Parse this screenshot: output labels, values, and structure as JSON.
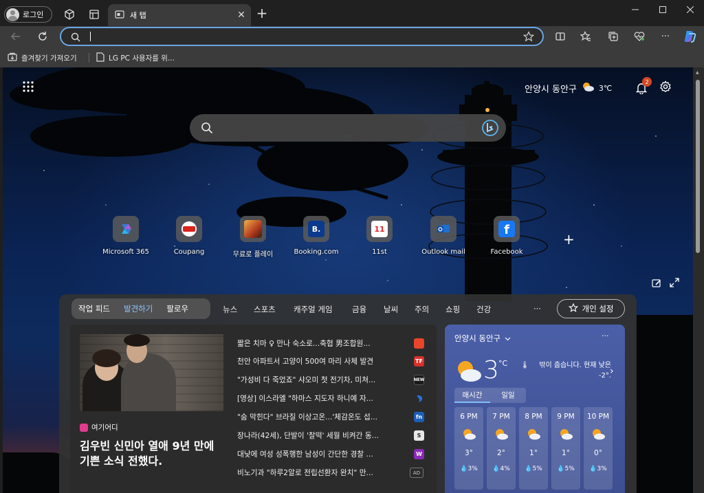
{
  "browser": {
    "profile_label": "로그인",
    "tab_title": "새 탭",
    "address_value": "",
    "favorites": [
      "즐겨찾기 가져오기",
      "LG PC 사용자를 위..."
    ]
  },
  "header": {
    "location": "안양시 동안구",
    "temperature": "3℃",
    "notification_count": "2"
  },
  "quick_links": [
    {
      "label": "Microsoft 365",
      "icon": "microsoft365-icon"
    },
    {
      "label": "Coupang",
      "icon": "coupang-icon"
    },
    {
      "label": "무료로 플레이",
      "icon": "game-icon"
    },
    {
      "label": "Booking.com",
      "icon": "booking-icon",
      "glyph": "B."
    },
    {
      "label": "11st",
      "icon": "11st-icon",
      "glyph": "11"
    },
    {
      "label": "Outlook mail",
      "icon": "outlook-icon"
    },
    {
      "label": "Facebook",
      "icon": "facebook-icon",
      "glyph": "f"
    }
  ],
  "feed": {
    "segments": [
      "작업 피드",
      "발견하기",
      "팔로우"
    ],
    "active_segment": "발견하기",
    "categories": [
      "뉴스",
      "스포츠",
      "캐주얼 게임",
      "금융",
      "날씨",
      "주의",
      "쇼핑",
      "건강"
    ],
    "more": "···",
    "personalize_label": "개인 설정",
    "hero": {
      "source": "여기어디",
      "title": "김우빈 신민아 열애 9년 만에 기쁜 소식 전했다."
    },
    "headlines": [
      {
        "text": "짧은 치마 ♀ 만나 숙소로...축협 男조합원...",
        "badge": "",
        "badge_color": "#e8452c"
      },
      {
        "text": "천안 아파트서 고양이 500여 마리 사체 발견",
        "badge": "TF",
        "badge_color": "#d8302a"
      },
      {
        "text": "\"가성비 다 죽었죠\" 샤오미 첫 전기차, 미쳐...",
        "badge": "NEW",
        "badge_color": "#1a1a1a"
      },
      {
        "text": "[영상] 이스라엘 \"하마스 지도자 하니예 자...",
        "badge": "",
        "badge_color": "#2a6fd6"
      },
      {
        "text": "\"숨 막힌다\" 브라질 이상고온...'체감온도 섭...",
        "badge": "fn",
        "badge_color": "#1d5fb8"
      },
      {
        "text": "장나라(42세), 단발이 '찰떡' 세월 비켜간 동...",
        "badge": "S",
        "badge_color": "#e8e8e8"
      },
      {
        "text": "대낮에 여성 성폭행한 남성이 간단한 경찰 ...",
        "badge": "W",
        "badge_color": "#8a2ab8"
      },
      {
        "text": "비노기과 \"하루2알로 전립선환자 완치\" 만...",
        "badge": "AD",
        "badge_color": "#3a3a3a"
      }
    ]
  },
  "weather": {
    "location": "안양시 동안구",
    "temperature": "3",
    "unit": "°C",
    "description": "밖이 춥습니다. 현재 낮은 -2°.",
    "tabs": [
      "매시간",
      "일일"
    ],
    "active_tab": "매시간",
    "more": "···",
    "hours": [
      {
        "time": "6 PM",
        "temp": "3°",
        "precip": "3%"
      },
      {
        "time": "7 PM",
        "temp": "2°",
        "precip": "4%"
      },
      {
        "time": "8 PM",
        "temp": "1°",
        "precip": "5%"
      },
      {
        "time": "9 PM",
        "temp": "1°",
        "precip": "5%"
      },
      {
        "time": "10 PM",
        "temp": "0°",
        "precip": "3%"
      }
    ]
  },
  "colors": {
    "accent": "#6aa5e4",
    "notification_badge": "#d24726",
    "weather_card": "#4b5fa8"
  }
}
